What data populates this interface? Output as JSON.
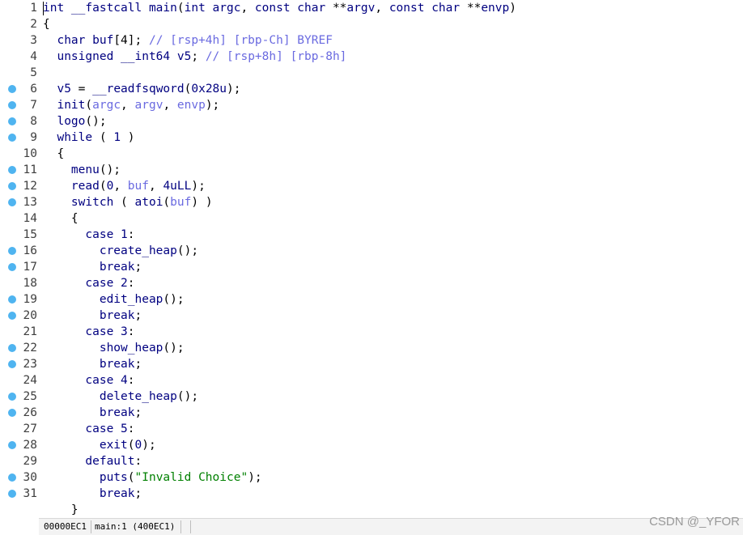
{
  "editor": {
    "lines": [
      {
        "num": "1",
        "bp": false,
        "tokens": [
          [
            "kw",
            "int "
          ],
          [
            "fn",
            "__fastcall main"
          ],
          [
            "br",
            "("
          ],
          [
            "kw",
            "int "
          ],
          [
            "var",
            "argc"
          ],
          [
            "br",
            ", "
          ],
          [
            "kw",
            "const char "
          ],
          [
            "br",
            "**"
          ],
          [
            "var",
            "argv"
          ],
          [
            "br",
            ", "
          ],
          [
            "kw",
            "const char "
          ],
          [
            "br",
            "**"
          ],
          [
            "var",
            "envp"
          ],
          [
            "br",
            ")"
          ]
        ]
      },
      {
        "num": "2",
        "bp": false,
        "tokens": [
          [
            "br",
            "{"
          ]
        ]
      },
      {
        "num": "3",
        "bp": false,
        "tokens": [
          [
            "kw",
            "  char "
          ],
          [
            "lvar",
            "buf"
          ],
          [
            "br",
            "[4]; "
          ],
          [
            "cmt",
            "// [rsp+4h] [rbp-Ch] BYREF"
          ]
        ]
      },
      {
        "num": "4",
        "bp": false,
        "tokens": [
          [
            "kw",
            "  unsigned __int64 "
          ],
          [
            "lvar",
            "v5"
          ],
          [
            "br",
            "; "
          ],
          [
            "cmt",
            "// [rsp+8h] [rbp-8h]"
          ]
        ]
      },
      {
        "num": "5",
        "bp": false,
        "tokens": []
      },
      {
        "num": "6",
        "bp": true,
        "tokens": [
          [
            "lvar",
            "  v5 "
          ],
          [
            "br",
            "= "
          ],
          [
            "fn",
            "__readfsqword"
          ],
          [
            "br",
            "("
          ],
          [
            "num",
            "0x28u"
          ],
          [
            "br",
            ");"
          ]
        ]
      },
      {
        "num": "7",
        "bp": true,
        "tokens": [
          [
            "fn",
            "  init"
          ],
          [
            "br",
            "("
          ],
          [
            "arg",
            "argc"
          ],
          [
            "br",
            ", "
          ],
          [
            "arg",
            "argv"
          ],
          [
            "br",
            ", "
          ],
          [
            "arg",
            "envp"
          ],
          [
            "br",
            ");"
          ]
        ]
      },
      {
        "num": "8",
        "bp": true,
        "tokens": [
          [
            "fn",
            "  logo"
          ],
          [
            "br",
            "();"
          ]
        ]
      },
      {
        "num": "9",
        "bp": true,
        "tokens": [
          [
            "kw",
            "  while "
          ],
          [
            "br",
            "( "
          ],
          [
            "num",
            "1"
          ],
          [
            "br",
            " )"
          ]
        ]
      },
      {
        "num": "10",
        "bp": false,
        "tokens": [
          [
            "br",
            "  {"
          ]
        ]
      },
      {
        "num": "11",
        "bp": true,
        "tokens": [
          [
            "fn",
            "    menu"
          ],
          [
            "br",
            "();"
          ]
        ]
      },
      {
        "num": "12",
        "bp": true,
        "tokens": [
          [
            "fn",
            "    read"
          ],
          [
            "br",
            "("
          ],
          [
            "num",
            "0"
          ],
          [
            "br",
            ", "
          ],
          [
            "arg",
            "buf"
          ],
          [
            "br",
            ", "
          ],
          [
            "num",
            "4uLL"
          ],
          [
            "br",
            ");"
          ]
        ]
      },
      {
        "num": "13",
        "bp": true,
        "tokens": [
          [
            "kw",
            "    switch "
          ],
          [
            "br",
            "( "
          ],
          [
            "fn",
            "atoi"
          ],
          [
            "br",
            "("
          ],
          [
            "arg",
            "buf"
          ],
          [
            "br",
            ") )"
          ]
        ]
      },
      {
        "num": "14",
        "bp": false,
        "tokens": [
          [
            "br",
            "    {"
          ]
        ]
      },
      {
        "num": "15",
        "bp": false,
        "tokens": [
          [
            "kw",
            "      case "
          ],
          [
            "num",
            "1"
          ],
          [
            "br",
            ":"
          ]
        ]
      },
      {
        "num": "16",
        "bp": true,
        "tokens": [
          [
            "fn",
            "        create_heap"
          ],
          [
            "br",
            "();"
          ]
        ]
      },
      {
        "num": "17",
        "bp": true,
        "tokens": [
          [
            "kw",
            "        break"
          ],
          [
            "br",
            ";"
          ]
        ]
      },
      {
        "num": "18",
        "bp": false,
        "tokens": [
          [
            "kw",
            "      case "
          ],
          [
            "num",
            "2"
          ],
          [
            "br",
            ":"
          ]
        ]
      },
      {
        "num": "19",
        "bp": true,
        "tokens": [
          [
            "fn",
            "        edit_heap"
          ],
          [
            "br",
            "();"
          ]
        ]
      },
      {
        "num": "20",
        "bp": true,
        "tokens": [
          [
            "kw",
            "        break"
          ],
          [
            "br",
            ";"
          ]
        ]
      },
      {
        "num": "21",
        "bp": false,
        "tokens": [
          [
            "kw",
            "      case "
          ],
          [
            "num",
            "3"
          ],
          [
            "br",
            ":"
          ]
        ]
      },
      {
        "num": "22",
        "bp": true,
        "tokens": [
          [
            "fn",
            "        show_heap"
          ],
          [
            "br",
            "();"
          ]
        ]
      },
      {
        "num": "23",
        "bp": true,
        "tokens": [
          [
            "kw",
            "        break"
          ],
          [
            "br",
            ";"
          ]
        ]
      },
      {
        "num": "24",
        "bp": false,
        "tokens": [
          [
            "kw",
            "      case "
          ],
          [
            "num",
            "4"
          ],
          [
            "br",
            ":"
          ]
        ]
      },
      {
        "num": "25",
        "bp": true,
        "tokens": [
          [
            "fn",
            "        delete_heap"
          ],
          [
            "br",
            "();"
          ]
        ]
      },
      {
        "num": "26",
        "bp": true,
        "tokens": [
          [
            "kw",
            "        break"
          ],
          [
            "br",
            ";"
          ]
        ]
      },
      {
        "num": "27",
        "bp": false,
        "tokens": [
          [
            "kw",
            "      case "
          ],
          [
            "num",
            "5"
          ],
          [
            "br",
            ":"
          ]
        ]
      },
      {
        "num": "28",
        "bp": true,
        "tokens": [
          [
            "fn",
            "        exit"
          ],
          [
            "br",
            "("
          ],
          [
            "num",
            "0"
          ],
          [
            "br",
            ");"
          ]
        ]
      },
      {
        "num": "29",
        "bp": false,
        "tokens": [
          [
            "kw",
            "      default"
          ],
          [
            "br",
            ":"
          ]
        ]
      },
      {
        "num": "30",
        "bp": true,
        "tokens": [
          [
            "fn",
            "        puts"
          ],
          [
            "br",
            "("
          ],
          [
            "str",
            "\"Invalid Choice\""
          ],
          [
            "br",
            ");"
          ]
        ]
      },
      {
        "num": "31",
        "bp": true,
        "tokens": [
          [
            "kw",
            "        break"
          ],
          [
            "br",
            ";"
          ]
        ]
      },
      {
        "num": "",
        "bp": false,
        "tokens": [
          [
            "br",
            "    }"
          ]
        ]
      }
    ]
  },
  "status_bar": {
    "address": "00000EC1",
    "location": "main:1 (400EC1)"
  },
  "watermark": "CSDN @_YFOR",
  "colors": {
    "breakpoint_dot": "#4fb4f0",
    "keyword": "#000080",
    "argument_comment": "#6a6ae0",
    "string": "#008000"
  }
}
